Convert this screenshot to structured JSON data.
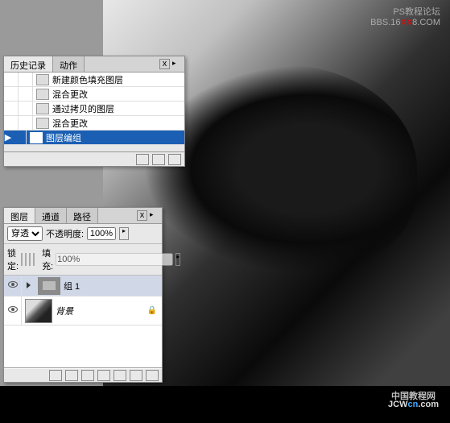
{
  "watermark": {
    "top_line1": "PS教程论坛",
    "top_line2_pre": "BBS.16",
    "top_line2_red": "XX",
    "top_line2_post": "8.COM",
    "bottom_cn": "中国教程网",
    "bottom_pre": "JCW",
    "bottom_blue": "cn",
    "bottom_post": ".com"
  },
  "history": {
    "tabs": [
      "历史记录",
      "动作"
    ],
    "close": "x",
    "items": [
      {
        "label": "新建颜色填充图层",
        "selected": false
      },
      {
        "label": "混合更改",
        "selected": false
      },
      {
        "label": "通过拷贝的图层",
        "selected": false
      },
      {
        "label": "混合更改",
        "selected": false
      },
      {
        "label": "图层编组",
        "selected": true
      }
    ]
  },
  "layers": {
    "tabs": [
      "图层",
      "通道",
      "路径"
    ],
    "close": "x",
    "blend_label": "",
    "blend_value": "穿透",
    "opacity_label": "不透明度:",
    "opacity_value": "100%",
    "lock_label": "锁定:",
    "fill_label": "填充:",
    "fill_value": "100%",
    "items": [
      {
        "name": "组 1",
        "type": "group",
        "visible": true,
        "selected": true,
        "locked": false
      },
      {
        "name": "背景",
        "type": "image",
        "visible": true,
        "selected": false,
        "locked": true
      }
    ]
  }
}
